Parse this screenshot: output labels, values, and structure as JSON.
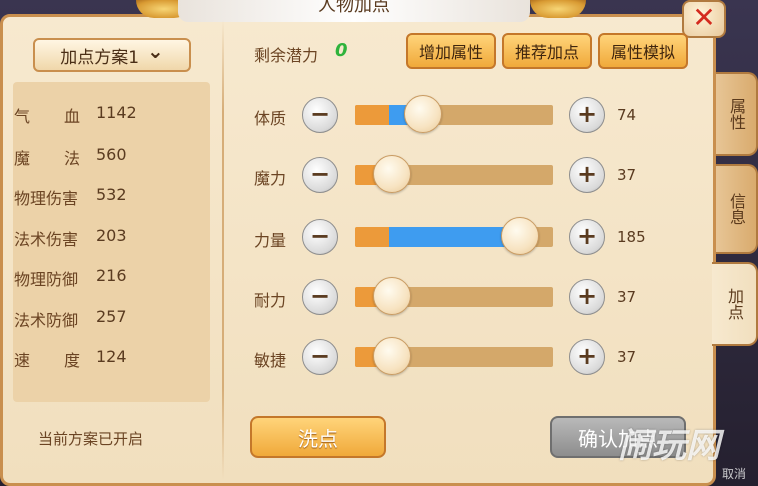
{
  "window": {
    "title": "人物加点",
    "close_glyph": "✕"
  },
  "side_tabs": [
    {
      "label": "属性"
    },
    {
      "label": "信息"
    },
    {
      "label": "加点"
    }
  ],
  "scheme": {
    "label": "加点方案1",
    "chevron": "⌄",
    "status": "当前方案已开启"
  },
  "stats": [
    {
      "name": "气血",
      "value": "1142"
    },
    {
      "name": "魔法",
      "value": "560"
    },
    {
      "name": "物理伤害",
      "value": "532"
    },
    {
      "name": "法术伤害",
      "value": "203"
    },
    {
      "name": "物理防御",
      "value": "216"
    },
    {
      "name": "法术防御",
      "value": "257"
    },
    {
      "name": "速度",
      "value": "124"
    }
  ],
  "potential": {
    "label": "剩余潜力",
    "value": "0"
  },
  "top_buttons": {
    "add_attr": "增加属性",
    "recommend": "推荐加点",
    "simulate": "属性模拟"
  },
  "attributes": [
    {
      "name": "体质",
      "value": "74",
      "base_fraction": 0.17,
      "level_fraction": 0.33
    },
    {
      "name": "魔力",
      "value": "37",
      "base_fraction": 0.17,
      "level_fraction": 0.17
    },
    {
      "name": "力量",
      "value": "185",
      "base_fraction": 0.17,
      "level_fraction": 0.82
    },
    {
      "name": "耐力",
      "value": "37",
      "base_fraction": 0.17,
      "level_fraction": 0.17
    },
    {
      "name": "敏捷",
      "value": "37",
      "base_fraction": 0.17,
      "level_fraction": 0.17
    }
  ],
  "controls": {
    "minus_glyph": "−",
    "plus_glyph": "+"
  },
  "bottom_buttons": {
    "wash": "洗点",
    "confirm": "确认加点"
  },
  "watermark": {
    "text": "闹玩网",
    "sub": "取消"
  },
  "colors": {
    "fill_orange": "#ec9a3a",
    "fill_blue": "#3e9cf0",
    "track": "#d4a86a",
    "potential_green": "#2fb33c"
  }
}
